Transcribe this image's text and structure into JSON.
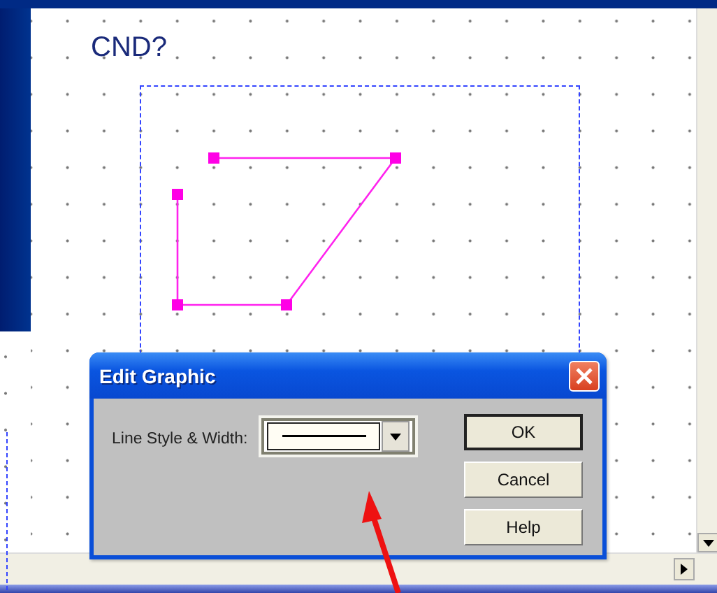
{
  "canvas": {
    "title": "CND?"
  },
  "dialog": {
    "title": "Edit Graphic",
    "field_label": "Line Style & Width:",
    "buttons": [
      {
        "label": "OK",
        "default": true
      },
      {
        "label": "Cancel",
        "default": false
      },
      {
        "label": "Help",
        "default": false
      }
    ]
  }
}
